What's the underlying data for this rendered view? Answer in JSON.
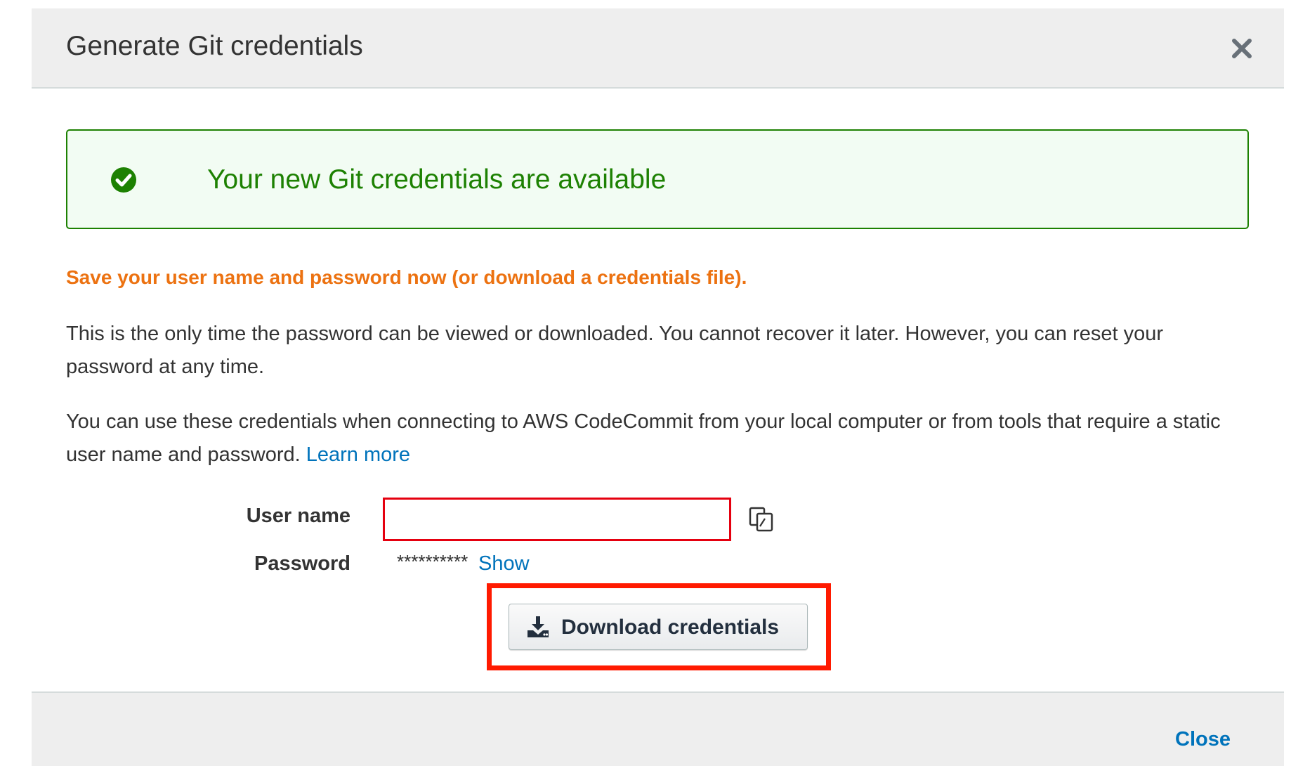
{
  "modal": {
    "title": "Generate Git credentials",
    "close_icon": "close-icon"
  },
  "alert": {
    "icon": "check-circle-icon",
    "text": "Your new Git credentials are available",
    "color": "#1d8102"
  },
  "warning": {
    "text": "Save your user name and password now (or download a credentials file).",
    "color": "#ec7211"
  },
  "paragraphs": {
    "p1": "This is the only time the password can be viewed or downloaded. You cannot recover it later. However, you can reset your password at any time.",
    "p2": "You can use these credentials when connecting to AWS CodeCommit from your local computer or from tools that require a static user name and password.",
    "learn_more": "Learn more"
  },
  "credentials": {
    "username_label": "User name",
    "username_value": "",
    "copy_icon": "copy-icon",
    "password_label": "Password",
    "password_masked": "**********",
    "show_label": "Show"
  },
  "download": {
    "icon": "download-icon",
    "label": "Download credentials"
  },
  "footer": {
    "close_label": "Close"
  },
  "colors": {
    "link": "#0073bb",
    "highlight": "#ff1a00",
    "header_bg": "#eeeeee"
  }
}
